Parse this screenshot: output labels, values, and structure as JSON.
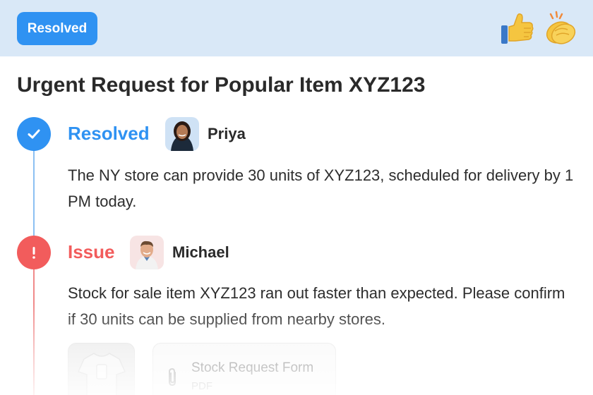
{
  "header": {
    "status_badge": "Resolved",
    "reactions": [
      {
        "icon": "thumbs-up-icon"
      },
      {
        "icon": "clapping-hands-icon"
      }
    ]
  },
  "ticket": {
    "title": "Urgent Request for Popular Item XYZ123"
  },
  "timeline": [
    {
      "type": "Resolved",
      "icon": "check-icon",
      "color": "#2F92F2",
      "author": "Priya",
      "message": "The NY store can provide 30 units of XYZ123, scheduled for delivery by 1 PM today."
    },
    {
      "type": "Issue",
      "icon": "exclamation-icon",
      "color": "#F25C5C",
      "author": "Michael",
      "message": "Stock for sale item XYZ123 ran out faster than expected. Please confirm if 30 units can be supplied from nearby stores.",
      "attachments": [
        {
          "kind": "image",
          "icon": "shirt-image-thumbnail"
        },
        {
          "kind": "file",
          "name": "Stock Request Form",
          "type": "PDF",
          "icon": "paperclip-icon"
        }
      ]
    }
  ]
}
